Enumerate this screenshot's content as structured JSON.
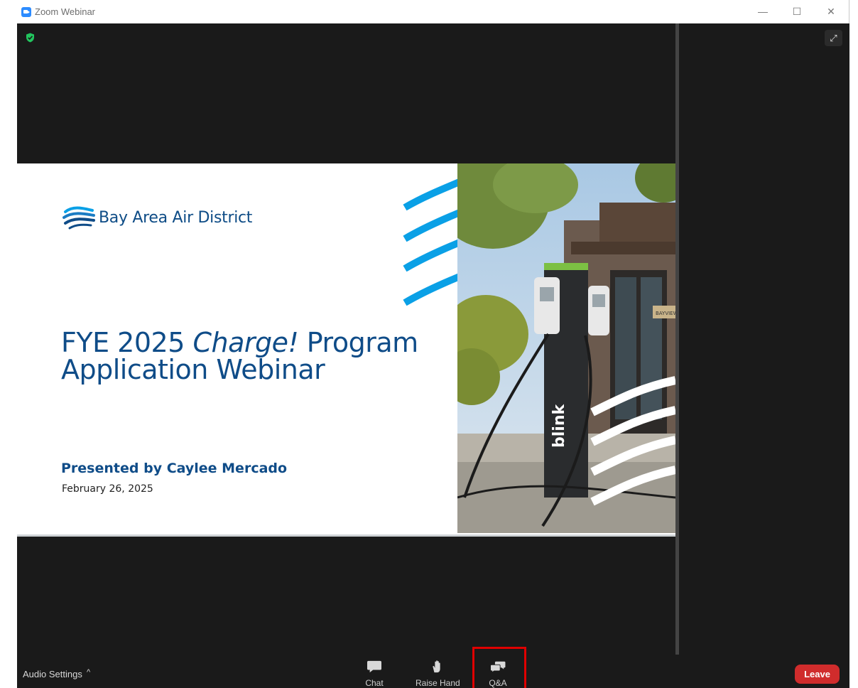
{
  "window": {
    "title": "Zoom Webinar",
    "controls": {
      "minimize": "—",
      "maximize": "☐",
      "close": "✕"
    }
  },
  "stage": {
    "encryption_icon": "shield-check-icon",
    "expand_icon": "⤢"
  },
  "slide": {
    "logo_text": "Bay Area Air District",
    "title_line1_pre": "FYE 2025 ",
    "title_line1_em": "Charge!",
    "title_line1_post": " Program",
    "title_line2": "Application Webinar",
    "presenter": "Presented by Caylee Mercado",
    "date": "February 26, 2025",
    "photo_sign": "BAYVIEW",
    "charger_brand": "blink"
  },
  "toolbar": {
    "audio_settings": "Audio Settings",
    "audio_caret": "^",
    "chat": "Chat",
    "raise_hand": "Raise Hand",
    "qa": "Q&A",
    "leave": "Leave"
  },
  "colors": {
    "brand_blue": "#0f4c88",
    "wave_blue": "#0aa0e6",
    "leave_red": "#d02c2c",
    "highlight_red": "#e00000",
    "stage_bg": "#1a1a1a"
  }
}
